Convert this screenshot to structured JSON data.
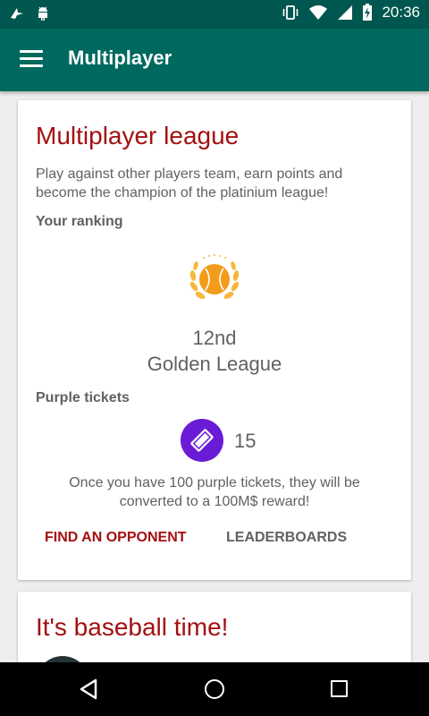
{
  "status_bar": {
    "time": "20:36",
    "left_icons": [
      "bird-notification-icon",
      "android-notification-icon"
    ],
    "right_icons": [
      "vibrate-icon",
      "wifi-icon",
      "signal-icon",
      "battery-charging-icon"
    ]
  },
  "app_bar": {
    "title": "Multiplayer",
    "menu_icon": "hamburger-menu-icon"
  },
  "league_card": {
    "title": "Multiplayer league",
    "description": "Play against other players team, earn points and become the champion of the platinium league!",
    "ranking_label": "Your ranking",
    "ranking_icon": "baseball-laurel-icon",
    "rank_position": "12nd",
    "rank_league": "Golden League",
    "tickets_label": "Purple tickets",
    "ticket_icon": "ticket-icon",
    "ticket_count": "15",
    "note": "Once you have 100 purple tickets, they will be converted to a 100M$ reward!",
    "find_opponent_label": "FIND AN OPPONENT",
    "leaderboards_label": "LEADERBOARDS"
  },
  "baseball_card": {
    "title": "It's baseball time!"
  },
  "nav_bar": {
    "icons": [
      "back-icon",
      "home-icon",
      "recent-apps-icon"
    ]
  },
  "colors": {
    "status_bar": "#00574f",
    "app_bar": "#00695f",
    "accent_red": "#a31010",
    "ticket_purple": "#6a1bd6",
    "baseball_orange": "#f39c1b"
  }
}
